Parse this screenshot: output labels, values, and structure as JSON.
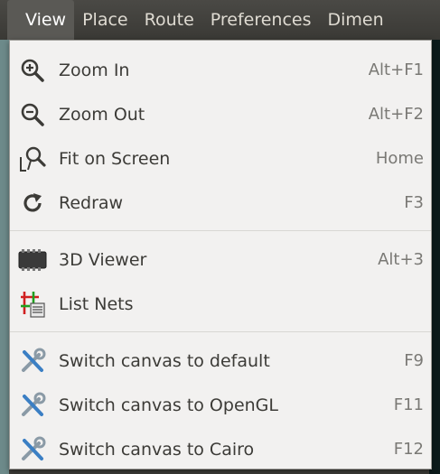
{
  "menubar": {
    "items": [
      "View",
      "Place",
      "Route",
      "Preferences",
      "Dimen"
    ]
  },
  "menu": {
    "groups": [
      [
        {
          "label": "Zoom In",
          "accel": "Alt+F1",
          "icon": "zoom-in-icon"
        },
        {
          "label": "Zoom Out",
          "accel": "Alt+F2",
          "icon": "zoom-out-icon"
        },
        {
          "label": "Fit on Screen",
          "accel": "Home",
          "icon": "fit-screen-icon"
        },
        {
          "label": "Redraw",
          "accel": "F3",
          "icon": "redraw-icon"
        }
      ],
      [
        {
          "label": "3D Viewer",
          "accel": "Alt+3",
          "icon": "3d-viewer-icon"
        },
        {
          "label": "List Nets",
          "accel": "",
          "icon": "list-nets-icon"
        }
      ],
      [
        {
          "label": "Switch canvas to default",
          "accel": "F9",
          "icon": "tools-icon"
        },
        {
          "label": "Switch canvas to OpenGL",
          "accel": "F11",
          "icon": "tools-icon"
        },
        {
          "label": "Switch canvas to Cairo",
          "accel": "F12",
          "icon": "tools-icon"
        }
      ]
    ]
  }
}
